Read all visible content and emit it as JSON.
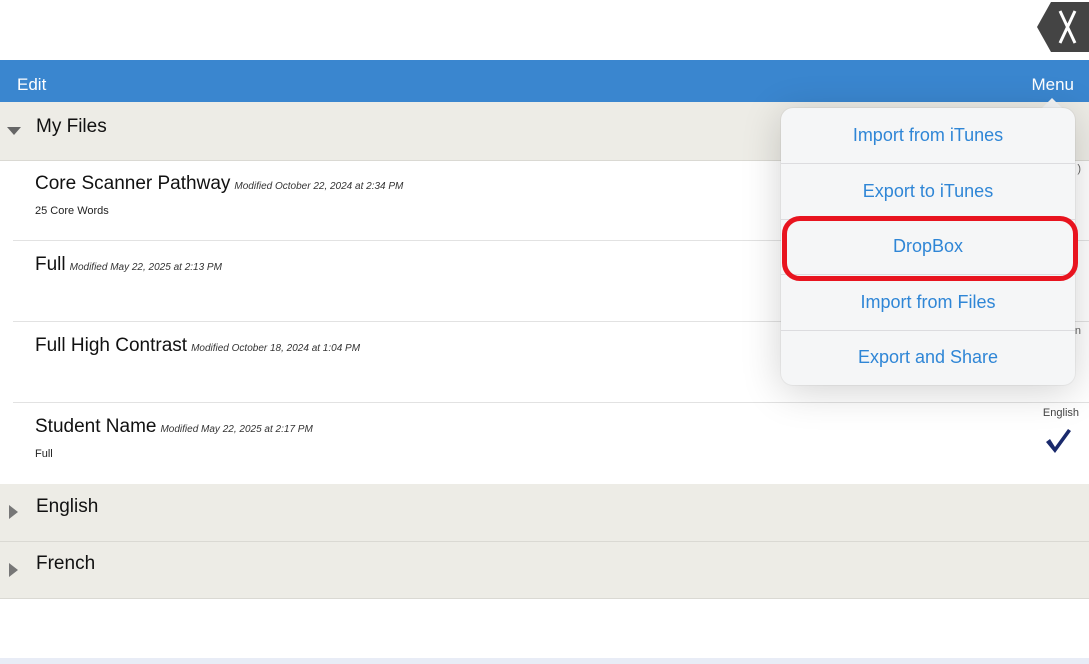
{
  "navbar": {
    "edit_label": "Edit",
    "menu_label": "Menu"
  },
  "close_button": {
    "icon": "close-x-icon",
    "color": "#444444"
  },
  "sections": [
    {
      "title": "My Files",
      "expanded": true
    },
    {
      "title": "English",
      "expanded": false
    },
    {
      "title": "French",
      "expanded": false
    }
  ],
  "files": [
    {
      "name": "Core Scanner Pathway",
      "modified": "Modified October 22, 2024 at 2:34 PM",
      "subtitle": "25 Core Words",
      "language": "",
      "selected": false
    },
    {
      "name": "Full",
      "modified": "Modified May 22, 2025 at 2:13 PM",
      "subtitle": "",
      "language": "",
      "selected": false
    },
    {
      "name": "Full High Contrast",
      "modified": "Modified October 18, 2024 at 1:04 PM",
      "subtitle": "",
      "language": "",
      "selected": false
    },
    {
      "name": "Student Name",
      "modified": "Modified May 22, 2025 at 2:17 PM",
      "subtitle": "Full",
      "language": "English",
      "selected": true
    }
  ],
  "menu_popover": {
    "items": [
      "Import from iTunes",
      "Export to iTunes",
      "DropBox",
      "Import from Files",
      "Export and Share"
    ],
    "highlighted_item": "DropBox"
  },
  "edge_glyphs": {
    "row1": ")",
    "row3": "n"
  },
  "colors": {
    "navbar": "#3a86cf",
    "menu_text": "#2f86d6",
    "highlight": "#e8141f",
    "checkmark": "#1a2a6c",
    "section_bg": "#edece6"
  }
}
